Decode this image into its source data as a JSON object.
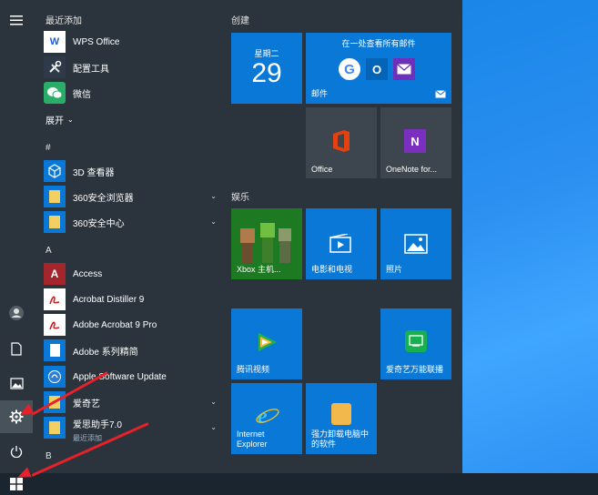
{
  "start_menu": {
    "recent_header": "最近添加",
    "expand_label": "展开",
    "expand_icon": "chevron-down-icon",
    "recent_apps": [
      {
        "label": "WPS Office",
        "icon": "wps-icon"
      },
      {
        "label": "配置工具",
        "icon": "tools-icon"
      },
      {
        "label": "微信",
        "icon": "wechat-icon"
      }
    ],
    "sections": {
      "hash": "#",
      "a": "A",
      "b": "B"
    },
    "apps": [
      {
        "label": "3D 查看器",
        "icon": "cube-icon"
      },
      {
        "label": "360安全浏览器",
        "icon": "folder-icon",
        "expandable": true
      },
      {
        "label": "360安全中心",
        "icon": "folder-icon",
        "expandable": true
      },
      {
        "label": "Access",
        "icon": "access-icon"
      },
      {
        "label": "Acrobat Distiller 9",
        "icon": "pdf-icon"
      },
      {
        "label": "Adobe Acrobat 9 Pro",
        "icon": "pdf-icon"
      },
      {
        "label": "Adobe 系列精简",
        "icon": "document-icon"
      },
      {
        "label": "Apple Software Update",
        "icon": "apple-update-icon"
      },
      {
        "label": "爱奇艺",
        "icon": "folder-icon",
        "expandable": true
      },
      {
        "label": "爱思助手7.0",
        "sub": "最近添加",
        "icon": "folder-icon",
        "expandable": true
      }
    ]
  },
  "rail": {
    "items": [
      "hamburger-icon",
      "user-icon",
      "document-icon",
      "pictures-icon",
      "gear-icon",
      "power-icon"
    ]
  },
  "tiles": {
    "group_create": "创建",
    "group_entertainment": "娱乐",
    "calendar": {
      "day": "星期二",
      "date": "29"
    },
    "mail": {
      "title": "在一处查看所有邮件",
      "label": "邮件"
    },
    "office": {
      "label": "Office"
    },
    "onenote": {
      "label": "OneNote for..."
    },
    "xbox": {
      "label": "Xbox 主机..."
    },
    "movies": {
      "label": "电影和电视"
    },
    "photos": {
      "label": "照片"
    },
    "tencent": {
      "label": "腾讯视频"
    },
    "iqiyi": {
      "label": "爱奇艺万能联播"
    },
    "ie": {
      "label": "Internet Explorer"
    },
    "uninstall": {
      "label": "强力卸载电脑中的软件"
    }
  },
  "colors": {
    "menu_bg": "#2b343c",
    "tile_blue": "#0a78d7",
    "tile_gray": "#3d464e",
    "annotation_red": "#e8202a"
  }
}
